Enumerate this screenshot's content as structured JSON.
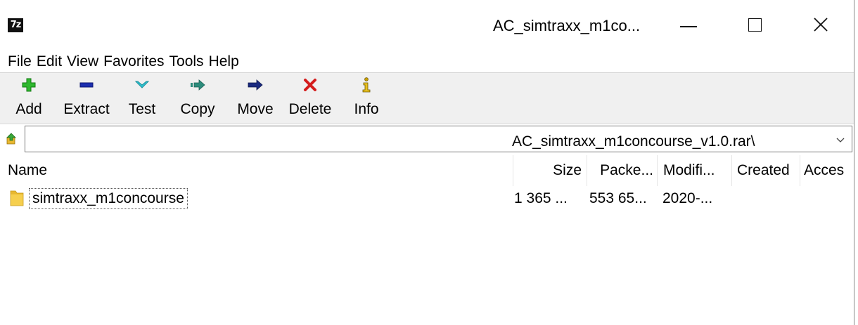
{
  "window": {
    "app_icon_text": "7z",
    "title": "AC_simtraxx_m1co...",
    "controls": {
      "minimize": "minimize-icon",
      "maximize": "maximize-icon",
      "close": "close-icon"
    }
  },
  "menu": [
    "File",
    "Edit",
    "View",
    "Favorites",
    "Tools",
    "Help"
  ],
  "toolbar": {
    "add": "Add",
    "extract": "Extract",
    "test": "Test",
    "copy": "Copy",
    "move": "Move",
    "delete": "Delete",
    "info": "Info"
  },
  "address": {
    "path": "AC_simtraxx_m1concourse_v1.0.rar\\"
  },
  "columns": {
    "name": "Name",
    "size": "Size",
    "packed": "Packe...",
    "modified": "Modifi...",
    "created": "Created",
    "accessed": "Acces"
  },
  "rows": [
    {
      "name": "simtraxx_m1concourse",
      "size": "1 365 ...",
      "packed": "553 65...",
      "modified": "2020-..."
    }
  ],
  "colors": {
    "add_green": "#2fb82f",
    "extract_blue": "#1c2fb0",
    "test_cyan": "#30c6d4",
    "copy_teal": "#2c8c7c",
    "move_navy": "#1a2a80",
    "delete_red": "#d41c1c",
    "folder_yellow": "#e8b830"
  }
}
